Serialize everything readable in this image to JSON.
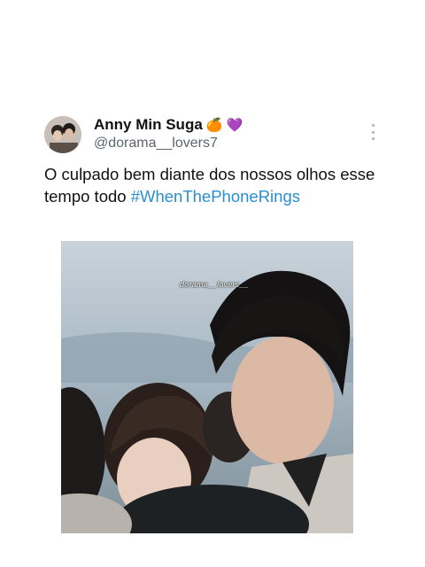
{
  "tweet": {
    "display_name": "Anny Min Suga",
    "name_emojis": [
      "🍊",
      "💜"
    ],
    "handle": "@dorama__lovers7",
    "text": "O culpado bem diante dos nossos olhos esse tempo todo ",
    "hashtag": "#WhenThePhoneRings"
  },
  "media": {
    "watermark": "dorama__lovers__"
  },
  "colors": {
    "hashtag": "#2a8fd1",
    "handle": "#5b6570",
    "text": "#111111"
  },
  "icons": {
    "more": "more-vertical-icon"
  }
}
